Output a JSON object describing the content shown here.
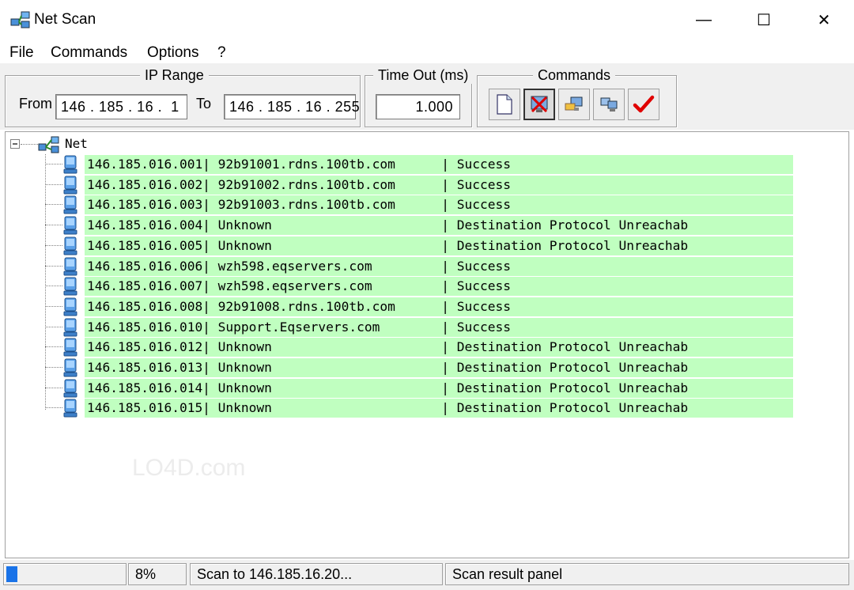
{
  "window": {
    "title": "Net Scan",
    "controls": {
      "minimize": "—",
      "maximize": "☐",
      "close": "✕"
    }
  },
  "menu": [
    "File",
    "Commands",
    "Options",
    "?"
  ],
  "ip_range": {
    "label": "IP Range",
    "from_label": "From",
    "from_value": "146 . 185 . 16 .  1",
    "to_label": "To",
    "to_value": "146 . 185 . 16 . 255"
  },
  "timeout": {
    "label": "Time Out (ms)",
    "value": "1.000"
  },
  "commands": {
    "label": "Commands",
    "buttons": [
      "new-document-icon",
      "stop-scan-icon",
      "network-computer-icon",
      "computers-icon",
      "check-icon"
    ]
  },
  "tree": {
    "root_label": "Net",
    "rows": [
      "146.185.016.001| 92b91001.rdns.100tb.com      | Success",
      "146.185.016.002| 92b91002.rdns.100tb.com      | Success",
      "146.185.016.003| 92b91003.rdns.100tb.com      | Success",
      "146.185.016.004| Unknown                      | Destination Protocol Unreachab",
      "146.185.016.005| Unknown                      | Destination Protocol Unreachab",
      "146.185.016.006| wzh598.eqservers.com         | Success",
      "146.185.016.007| wzh598.eqservers.com         | Success",
      "146.185.016.008| 92b91008.rdns.100tb.com      | Success",
      "146.185.016.010| Support.Eqservers.com        | Success",
      "146.185.016.012| Unknown                      | Destination Protocol Unreachab",
      "146.185.016.013| Unknown                      | Destination Protocol Unreachab",
      "146.185.016.014| Unknown                      | Destination Protocol Unreachab",
      "146.185.016.015| Unknown                      | Destination Protocol Unreachab"
    ]
  },
  "status": {
    "progress": 0.08,
    "percent": "8%",
    "scan_text": "Scan to 146.185.16.20...",
    "panel_text": "Scan result panel"
  },
  "watermark": "LO4D.com",
  "colors": {
    "row_bg": "#c0ffc0",
    "progress": "#1a73e8",
    "check": "#e00000"
  }
}
